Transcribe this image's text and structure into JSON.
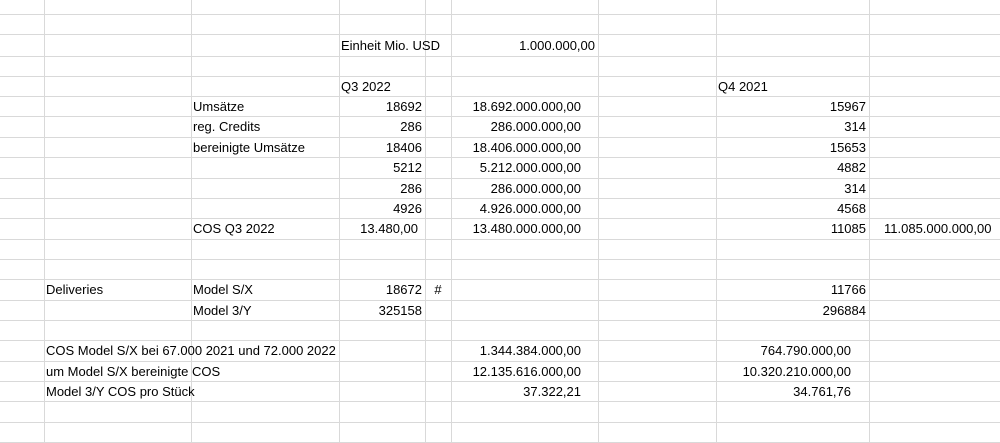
{
  "sheet": {
    "einheit_label": "Einheit Mio. USD",
    "einheit_value": "1.000.000,00",
    "q3_header": "Q3 2022",
    "q4_header": "Q4 2021",
    "rows": {
      "umsaetze": {
        "label": "Umsätze",
        "q3": "18692",
        "q3_usd": "18.692.000.000,00",
        "q4": "15967"
      },
      "credits": {
        "label": "reg. Credits",
        "q3": "286",
        "q3_usd": "286.000.000,00",
        "q4": "314"
      },
      "bereinigt": {
        "label": "bereinigte Umsätze",
        "q3": "18406",
        "q3_usd": "18.406.000.000,00",
        "q4": "15653"
      },
      "r8": {
        "q3": "5212",
        "q3_usd": "5.212.000.000,00",
        "q4": "4882"
      },
      "r9": {
        "q3": "286",
        "q3_usd": "286.000.000,00",
        "q4": "314"
      },
      "r10": {
        "q3": "4926",
        "q3_usd": "4.926.000.000,00",
        "q4": "4568"
      },
      "cos": {
        "label": "COS Q3 2022",
        "q3": "13.480,00",
        "q3_usd": "13.480.000.000,00",
        "q4": "11085",
        "q4_usd": "11.085.000.000,00"
      }
    },
    "deliveries": {
      "label": "Deliveries",
      "model_sx": {
        "label": "Model S/X",
        "q3": "18672",
        "marker": "#",
        "q4": "11766"
      },
      "model_3y": {
        "label": "Model 3/Y",
        "q3": "325158",
        "q4": "296884"
      }
    },
    "summary": {
      "cos_sx": {
        "label": "COS Model S/X bei 67.000 2021 und 72.000 2022",
        "q3": "1.344.384.000,00",
        "q4": "764.790.000,00"
      },
      "bereinigte_cos": {
        "label": "um Model S/X bereinigte COS",
        "q3": "12.135.616.000,00",
        "q4": "10.320.210.000,00"
      },
      "cos_pro_stueck": {
        "label": "Model 3/Y COS pro Stück",
        "q3": "37.322,21",
        "q4": "34.761,76"
      }
    }
  }
}
